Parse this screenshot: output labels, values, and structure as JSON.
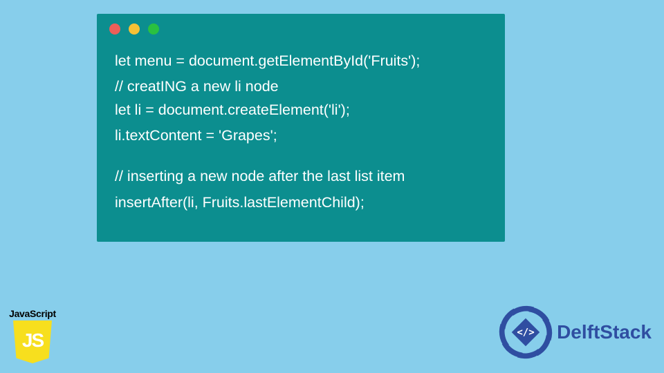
{
  "code": {
    "line1": "let menu = document.getElementById('Fruits');",
    "line2": "// creatING a new li node",
    "line3": "let li = document.createElement('li');",
    "line4": "li.textContent = 'Grapes';",
    "line5": "// inserting a new node after the last list item",
    "line6": "insertAfter(li, Fruits.lastElementChild);"
  },
  "badges": {
    "js_label": "JavaScript",
    "js_glyph": "JS",
    "delft_name": "DelftStack"
  },
  "colors": {
    "background": "#87ceeb",
    "window": "#0c8e8f",
    "code_text": "#ffffff",
    "js_yellow": "#f7df1e",
    "delft_blue": "#2f4ea1"
  }
}
